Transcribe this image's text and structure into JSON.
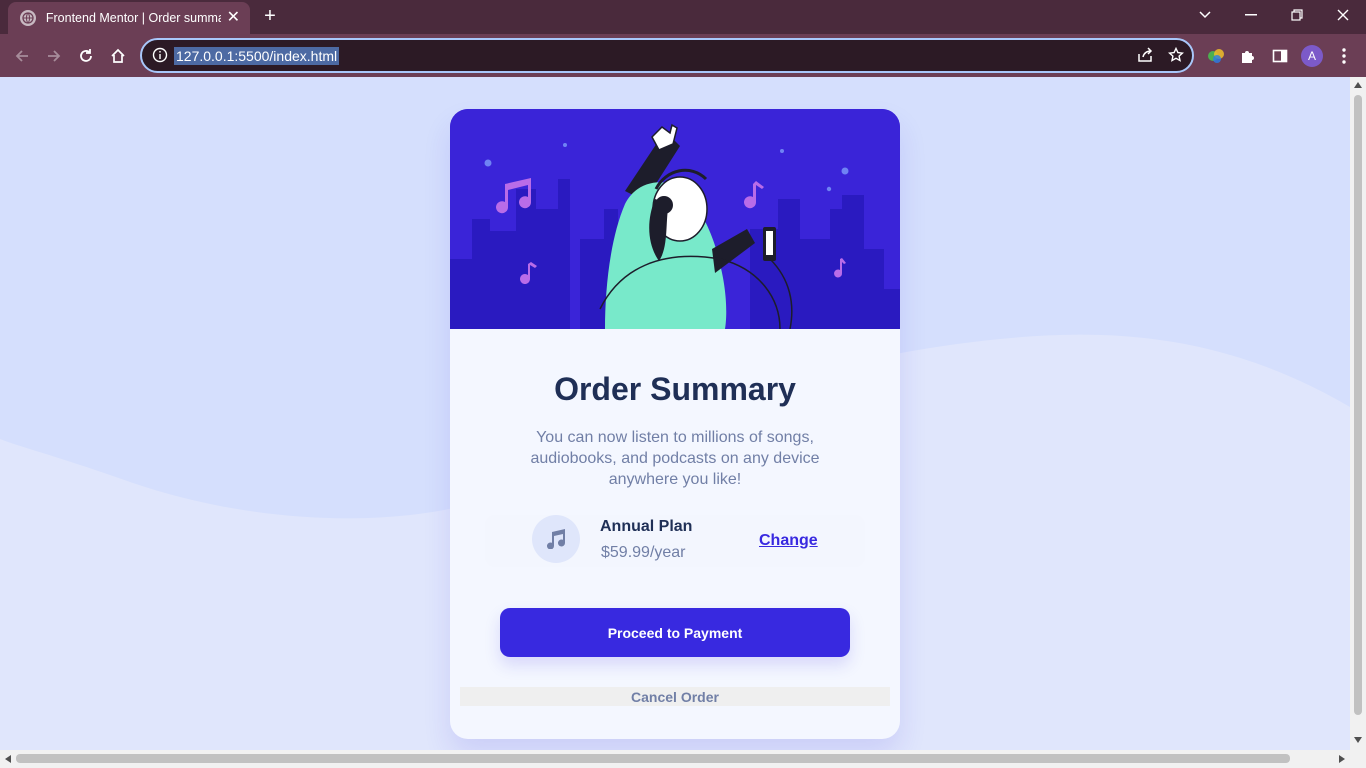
{
  "browser": {
    "tab_title": "Frontend Mentor | Order summary",
    "new_tab_symbol": "+",
    "url": "127.0.0.1:5500/index.html",
    "profile_initial": "A"
  },
  "card": {
    "heading": "Order Summary",
    "description": "You can now listen to millions of songs, audiobooks, and podcasts on any device anywhere you like!",
    "plan": {
      "name": "Annual Plan",
      "price": "$59.99/year",
      "change_label": "Change"
    },
    "pay_label": "Proceed to Payment",
    "cancel_label": "Cancel Order"
  },
  "colors": {
    "primary": "#3829e0",
    "heading": "#1f2f56",
    "muted": "#717fa6",
    "page_bg": "#e0e6fc",
    "hero_bg": "#3a24d8"
  }
}
